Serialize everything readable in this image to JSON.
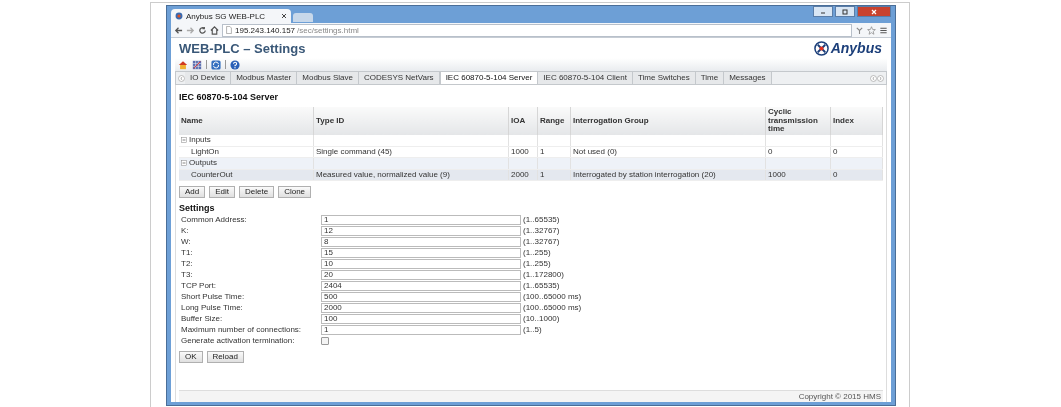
{
  "browser": {
    "tab_title": "Anybus SG WEB-PLC",
    "address_host": "195.243.140.157",
    "address_path": "/sec/settings.html"
  },
  "page": {
    "title": "WEB-PLC – Settings",
    "logo": "Anybus"
  },
  "tabs": [
    {
      "label": "IO Device",
      "selected": false
    },
    {
      "label": "Modbus Master",
      "selected": false
    },
    {
      "label": "Modbus Slave",
      "selected": false
    },
    {
      "label": "CODESYS NetVars",
      "selected": false
    },
    {
      "label": "IEC 60870-5-104 Server",
      "selected": true
    },
    {
      "label": "IEC 60870-5-104 Client",
      "selected": false
    },
    {
      "label": "Time Switches",
      "selected": false
    },
    {
      "label": "Time",
      "selected": false
    },
    {
      "label": "Messages",
      "selected": false
    }
  ],
  "section_title": "IEC 60870-5-104 Server",
  "table": {
    "columns": [
      "Name",
      "Type ID",
      "IOA",
      "Range",
      "Interrogation Group",
      "Cyclic transmission time",
      "Index"
    ],
    "rows": [
      {
        "name": "Inputs",
        "expanded": true,
        "children": [
          {
            "name": "LightOn",
            "cells": [
              "Single command (45)",
              "1000",
              "1",
              "Not used (0)",
              "0",
              "0"
            ]
          }
        ]
      },
      {
        "name": "Outputs",
        "expanded": true,
        "children": [
          {
            "name": "CounterOut",
            "cells": [
              "Measured value, normalized value (9)",
              "2000",
              "1",
              "Interrogated by station interrogation (20)",
              "1000",
              "0"
            ]
          }
        ]
      }
    ]
  },
  "table_buttons": [
    "Add",
    "Edit",
    "Delete",
    "Clone"
  ],
  "settings_title": "Settings",
  "settings": [
    {
      "kind": "text",
      "label": "Common Address:",
      "value": "1",
      "range": "(1..65535)"
    },
    {
      "kind": "text",
      "label": "K:",
      "value": "12",
      "range": "(1..32767)"
    },
    {
      "kind": "text",
      "label": "W:",
      "value": "8",
      "range": "(1..32767)"
    },
    {
      "kind": "text",
      "label": "T1:",
      "value": "15",
      "range": "(1..255)"
    },
    {
      "kind": "text",
      "label": "T2:",
      "value": "10",
      "range": "(1..255)"
    },
    {
      "kind": "text",
      "label": "T3:",
      "value": "20",
      "range": "(1..172800)"
    },
    {
      "kind": "text",
      "label": "TCP Port:",
      "value": "2404",
      "range": "(1..65535)"
    },
    {
      "kind": "text",
      "label": "Short Pulse Time:",
      "value": "500",
      "range": "(100..65000 ms)"
    },
    {
      "kind": "text",
      "label": "Long Pulse Time:",
      "value": "2000",
      "range": "(100..65000 ms)"
    },
    {
      "kind": "text",
      "label": "Buffer Size:",
      "value": "100",
      "range": "(10..1000)"
    },
    {
      "kind": "text",
      "label": "Maximum number of connections:",
      "value": "1",
      "range": "(1..5)"
    },
    {
      "kind": "checkbox",
      "label": "Generate activation termination:",
      "checked": false
    }
  ],
  "form_buttons": [
    "OK",
    "Reload"
  ],
  "copyright": "Copyright © 2015 HMS"
}
